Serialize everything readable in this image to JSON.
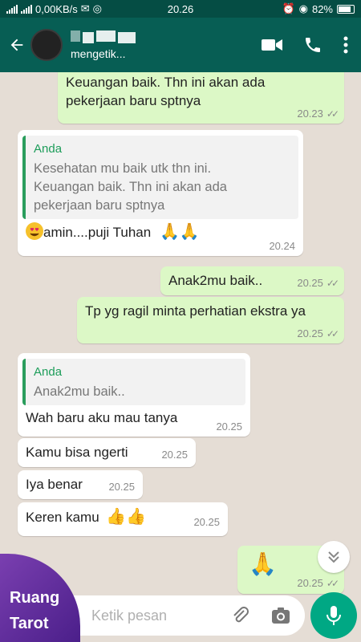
{
  "status_bar": {
    "network": "0,00KB/s",
    "time": "20.26",
    "battery": "82%"
  },
  "header": {
    "status": "mengetik..."
  },
  "messages": [
    {
      "id": "m1",
      "type": "out",
      "text": "Keuangan baik. Thn ini akan ada\npekerjaan baru sptnya",
      "time": "20.23"
    },
    {
      "id": "m2",
      "type": "in",
      "quote_author": "Anda",
      "quote_text": "Kesehatan mu baik utk thn ini.\nKeuangan baik. Thn ini akan ada\npekerjaan baru sptnya",
      "text": "amin....puji Tuhan",
      "time": "20.24"
    },
    {
      "id": "m3",
      "type": "out",
      "text": "Anak2mu baik..",
      "time": "20.25"
    },
    {
      "id": "m4",
      "type": "out",
      "text": "Tp yg ragil minta perhatian ekstra ya",
      "time": "20.25"
    },
    {
      "id": "m5",
      "type": "in",
      "quote_author": "Anda",
      "quote_text": "Anak2mu baik..",
      "text": "Wah baru aku mau tanya",
      "time": "20.25"
    },
    {
      "id": "m6",
      "type": "in",
      "text": "Kamu bisa ngerti",
      "time": "20.25"
    },
    {
      "id": "m7",
      "type": "in",
      "text": "Iya benar",
      "time": "20.25"
    },
    {
      "id": "m8",
      "type": "in",
      "text": "Keren kamu",
      "time": "20.25"
    },
    {
      "id": "m9",
      "type": "out",
      "text": "",
      "time": "20.25"
    }
  ],
  "input": {
    "placeholder": "Ketik pesan"
  },
  "watermark": {
    "line1": "Ruang",
    "line2": "Tarot"
  },
  "colors": {
    "header": "#075e54",
    "outgoing": "#dcf8c6",
    "incoming": "#ffffff",
    "accent": "#00a884",
    "watermark": "#6a35a4"
  }
}
